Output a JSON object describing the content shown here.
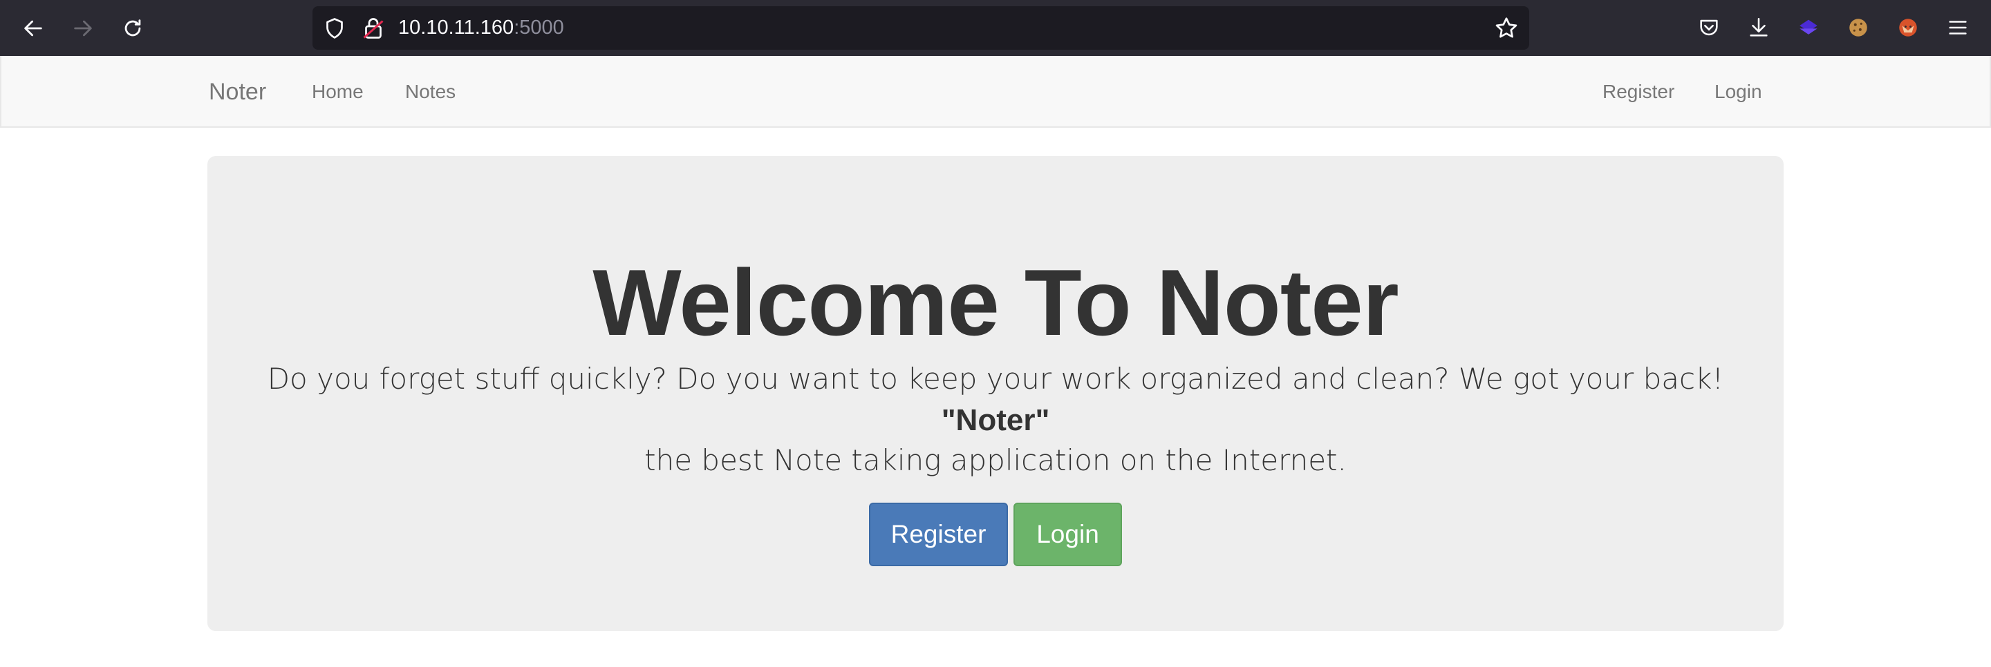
{
  "browser": {
    "url_host": "10.10.11.160",
    "url_port": ":5000"
  },
  "navbar": {
    "brand": "Noter",
    "left_links": [
      "Home",
      "Notes"
    ],
    "right_links": [
      "Register",
      "Login"
    ]
  },
  "hero": {
    "title": "Welcome To Noter",
    "line1": "Do you forget stuff quickly? Do you want to keep your work organized and clean? We got your back!",
    "strong": "\"Noter\"",
    "line3": "the best Note taking application on the Internet.",
    "register_button": "Register",
    "login_button": "Login"
  },
  "colors": {
    "primary": "#4a7ab8",
    "success": "#6cb46a",
    "jumbotron_bg": "#eeeeee",
    "navbar_bg": "#f8f8f8"
  }
}
